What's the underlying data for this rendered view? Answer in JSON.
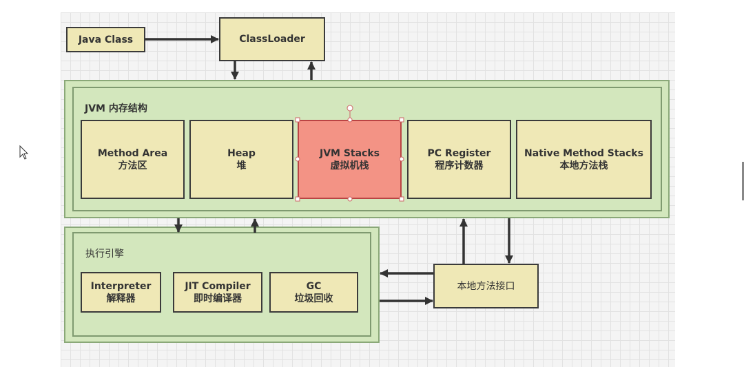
{
  "nodes": {
    "java_class": "Java Class",
    "classloader": "ClassLoader",
    "native_interface": "本地方法接口"
  },
  "jvm_memory": {
    "title": "JVM 内存结构",
    "areas": [
      {
        "en": "Method Area",
        "zh": "方法区"
      },
      {
        "en": "Heap",
        "zh": "堆"
      },
      {
        "en": "JVM Stacks",
        "zh": "虚拟机栈"
      },
      {
        "en": "PC Register",
        "zh": "程序计数器"
      },
      {
        "en": "Native Method Stacks",
        "zh": "本地方法栈"
      }
    ]
  },
  "exec_engine": {
    "title": "执行引擎",
    "parts": [
      {
        "en": "Interpreter",
        "zh": "解释器"
      },
      {
        "en": "JIT Compiler",
        "zh": "即时编译器"
      },
      {
        "en": "GC",
        "zh": "垃圾回收"
      }
    ]
  },
  "colors": {
    "box": "#efe8b6",
    "group": "#d3e7bd",
    "selected": "#f39385"
  },
  "selected_node": "JVM Stacks"
}
